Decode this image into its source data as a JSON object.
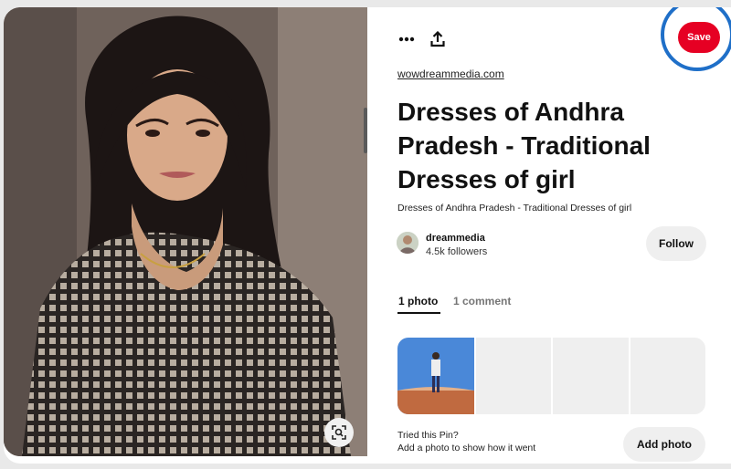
{
  "pin": {
    "source_link": "wowdreammedia.com",
    "title": "Dresses of Andhra Pradesh - Traditional Dresses of girl",
    "description": "Dresses of Andhra Pradesh - Traditional Dresses of girl",
    "image_icon": "lens-search-icon"
  },
  "toolbar": {
    "more_icon": "more-options-icon",
    "share_icon": "share-upload-icon",
    "save_label": "Save",
    "accent_color": "#e60023",
    "highlight_ring_color": "#1f6fc8"
  },
  "creator": {
    "name": "dreammedia",
    "followers": "4.5k followers",
    "follow_label": "Follow"
  },
  "tabs": [
    {
      "label": "1 photo",
      "active": true
    },
    {
      "label": "1 comment",
      "active": false
    }
  ],
  "tried": {
    "title": "Tried this Pin?",
    "subtitle": "Add a photo to show how it went",
    "add_photo_label": "Add photo"
  }
}
